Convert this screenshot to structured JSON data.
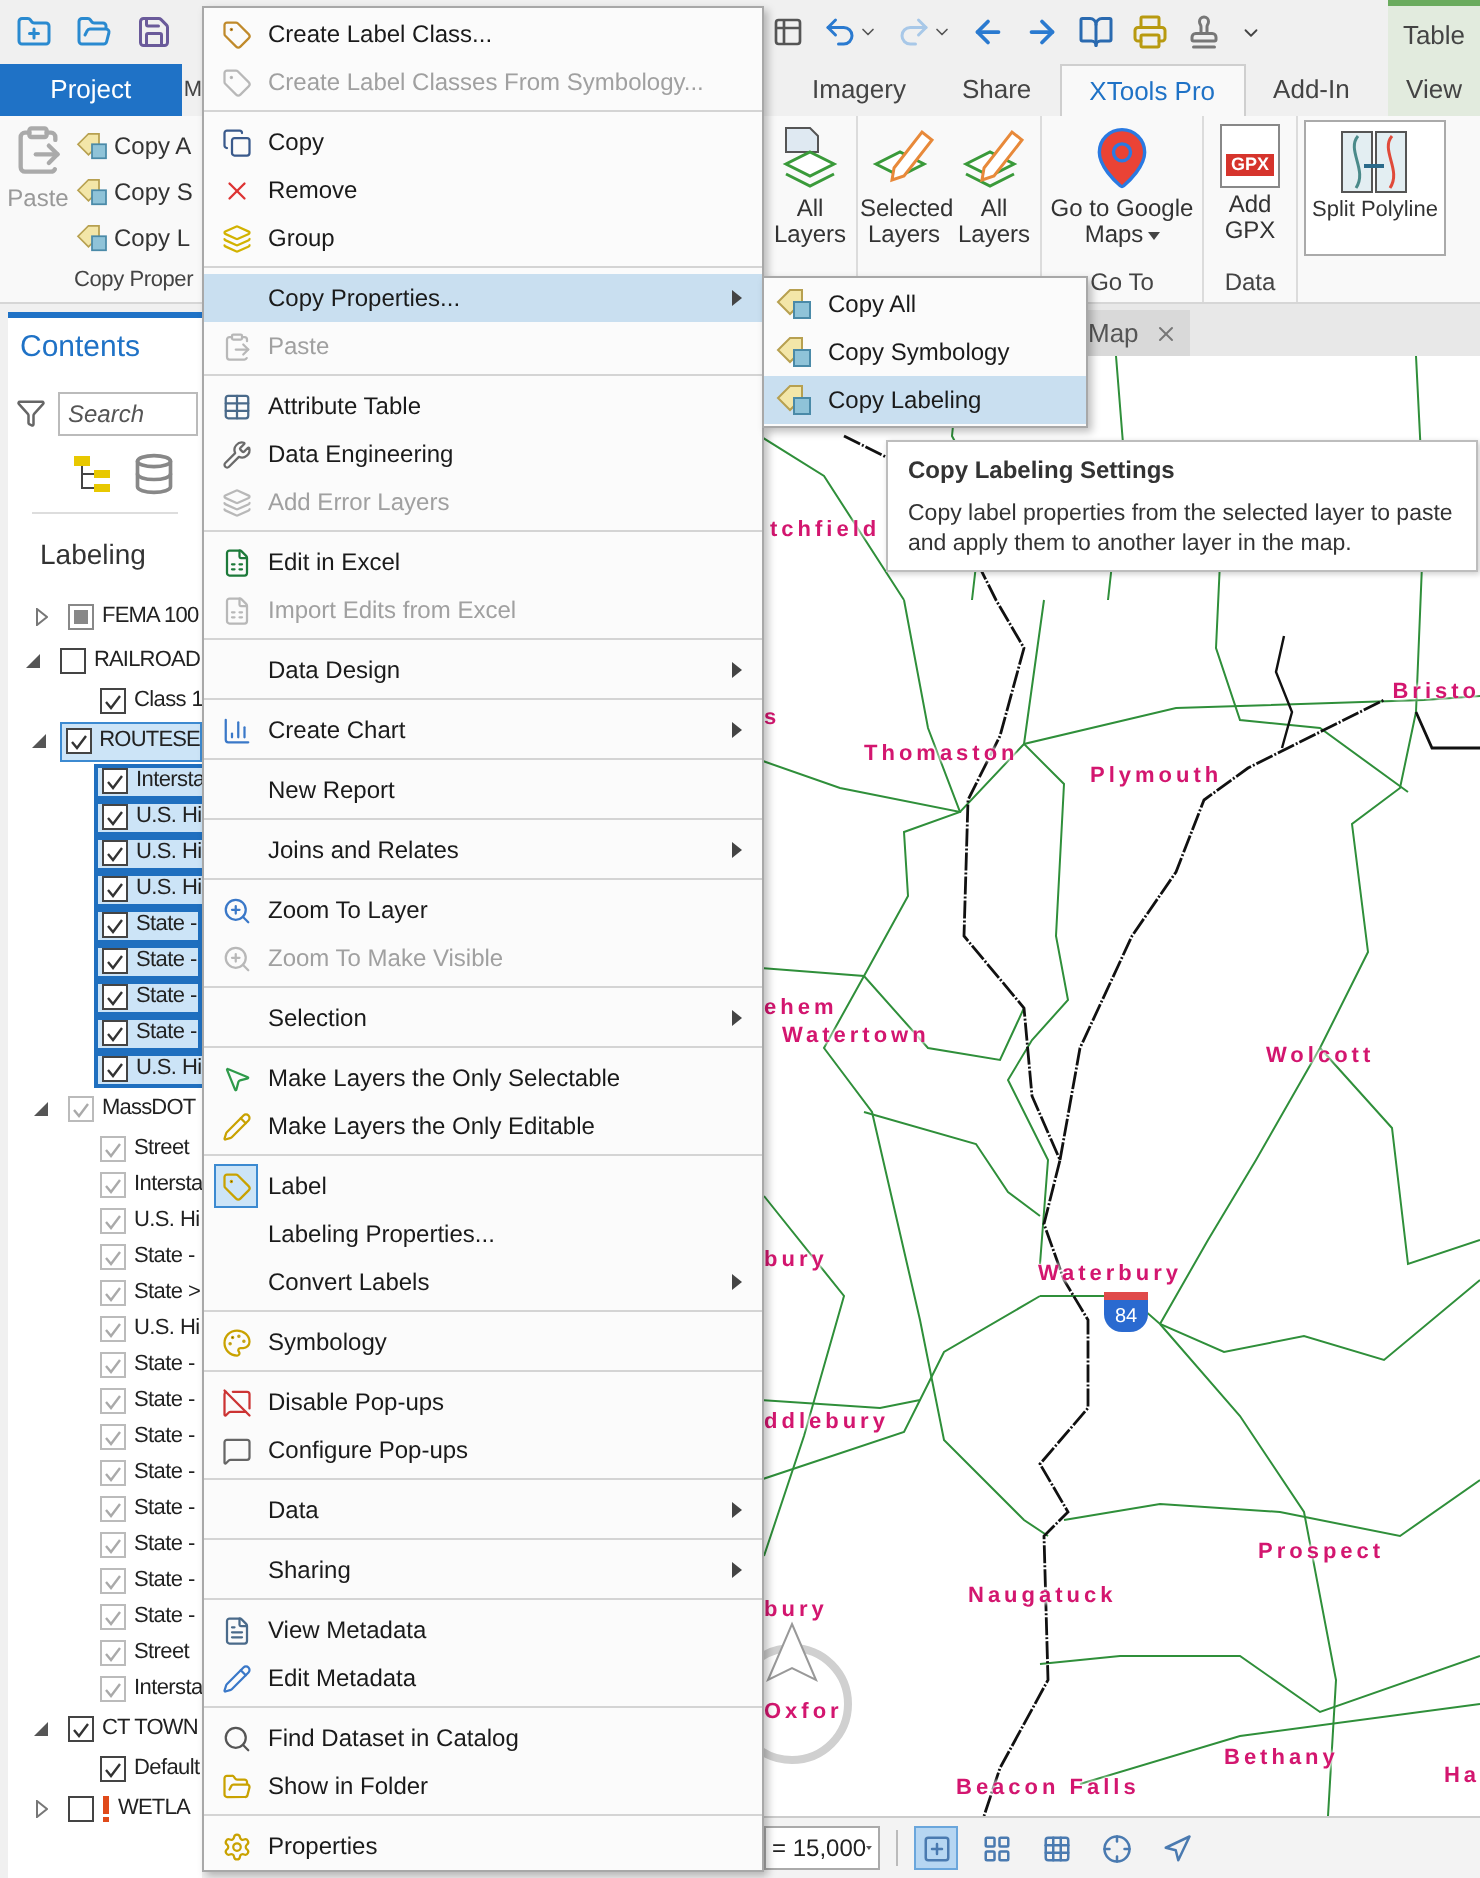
{
  "tabs_left": [
    {
      "label": "Project",
      "kind": "backstage",
      "selected": false
    },
    {
      "label": "M",
      "kind": "tab",
      "selected": false
    }
  ],
  "tabs_right": [
    {
      "label": "Imagery",
      "kind": "tab",
      "selected": false
    },
    {
      "label": "Share",
      "kind": "tab",
      "selected": false
    },
    {
      "label": "XTools Pro",
      "kind": "tab",
      "selected": true
    },
    {
      "label": "Add-In",
      "kind": "tab",
      "selected": false
    },
    {
      "label": "View",
      "kind": "contextual",
      "selected": false
    }
  ],
  "contextual_label": "Table",
  "ribbon_left": {
    "paste": "Paste",
    "buttons": [
      "Copy A",
      "Copy S",
      "Copy L"
    ],
    "group_label": "Copy Proper"
  },
  "ribbon_groups": [
    {
      "buttons": [
        {
          "label": "All Layers",
          "dropdown": false
        }
      ]
    },
    {
      "buttons": [
        {
          "label": "Selected Layers",
          "dropdown": false
        },
        {
          "label": "All Layers",
          "dropdown": false
        }
      ]
    },
    {
      "label": "Go To",
      "buttons": [
        {
          "label": "Go to Google Maps",
          "dropdown": true
        }
      ]
    },
    {
      "label": "Data",
      "buttons": [
        {
          "label": "Add GPX",
          "dropdown": false,
          "icon_text": "GPX"
        }
      ]
    },
    {
      "buttons": [
        {
          "label": "Split Polyline",
          "dropdown": false
        }
      ]
    }
  ],
  "contents": {
    "title": "Contents",
    "search_placeholder": "Search",
    "heading": "Labeling",
    "layers": [
      {
        "label": "FEMA 100",
        "expanded": false,
        "checked": false,
        "partial": true,
        "dimmed": false,
        "selected": false,
        "warning": false
      },
      {
        "label": "RAILROAD",
        "expanded": true,
        "checked": false,
        "partial": false,
        "dimmed": false,
        "selected": false,
        "warning": false,
        "children": [
          {
            "label": "Class 1",
            "checked": true,
            "dimmed": false,
            "selected": false
          }
        ]
      },
      {
        "label": "ROUTESE",
        "expanded": true,
        "checked": true,
        "partial": false,
        "dimmed": false,
        "selected": true,
        "warning": false,
        "children": [
          {
            "label": "Intersta",
            "checked": true,
            "dimmed": false,
            "selected": true
          },
          {
            "label": "U.S. Hi",
            "checked": true,
            "dimmed": false,
            "selected": true
          },
          {
            "label": "U.S. Hi",
            "checked": true,
            "dimmed": false,
            "selected": true
          },
          {
            "label": "U.S. Hi",
            "checked": true,
            "dimmed": false,
            "selected": true
          },
          {
            "label": "State -",
            "checked": true,
            "dimmed": false,
            "selected": true
          },
          {
            "label": "State -",
            "checked": true,
            "dimmed": false,
            "selected": true
          },
          {
            "label": "State -",
            "checked": true,
            "dimmed": false,
            "selected": true
          },
          {
            "label": "State -",
            "checked": true,
            "dimmed": false,
            "selected": true
          },
          {
            "label": "U.S. Hi",
            "checked": true,
            "dimmed": false,
            "selected": true
          }
        ]
      },
      {
        "label": "MassDOT",
        "expanded": true,
        "checked": true,
        "partial": false,
        "dimmed": true,
        "selected": false,
        "warning": false,
        "children": [
          {
            "label": "Street",
            "checked": true,
            "dimmed": true,
            "selected": false
          },
          {
            "label": "Intersta",
            "checked": true,
            "dimmed": true,
            "selected": false
          },
          {
            "label": "U.S. Hi",
            "checked": true,
            "dimmed": true,
            "selected": false
          },
          {
            "label": "State -",
            "checked": true,
            "dimmed": true,
            "selected": false
          },
          {
            "label": "State >",
            "checked": true,
            "dimmed": true,
            "selected": false
          },
          {
            "label": "U.S. Hi",
            "checked": true,
            "dimmed": true,
            "selected": false
          },
          {
            "label": "State -",
            "checked": true,
            "dimmed": true,
            "selected": false
          },
          {
            "label": "State -",
            "checked": true,
            "dimmed": true,
            "selected": false
          },
          {
            "label": "State -",
            "checked": true,
            "dimmed": true,
            "selected": false
          },
          {
            "label": "State -",
            "checked": true,
            "dimmed": true,
            "selected": false
          },
          {
            "label": "State -",
            "checked": true,
            "dimmed": true,
            "selected": false
          },
          {
            "label": "State -",
            "checked": true,
            "dimmed": true,
            "selected": false
          },
          {
            "label": "State -",
            "checked": true,
            "dimmed": true,
            "selected": false
          },
          {
            "label": "State -",
            "checked": true,
            "dimmed": true,
            "selected": false
          },
          {
            "label": "Street",
            "checked": true,
            "dimmed": true,
            "selected": false
          },
          {
            "label": "Intersta",
            "checked": true,
            "dimmed": true,
            "selected": false
          }
        ]
      },
      {
        "label": "CT TOWN",
        "expanded": true,
        "checked": true,
        "partial": false,
        "dimmed": false,
        "selected": false,
        "warning": false,
        "children": [
          {
            "label": "Default",
            "checked": true,
            "dimmed": false,
            "selected": false
          }
        ]
      },
      {
        "label": "WETLA",
        "expanded": false,
        "checked": false,
        "partial": false,
        "dimmed": false,
        "selected": false,
        "warning": true
      }
    ]
  },
  "context_menu": {
    "groups": [
      [
        {
          "label": "Create Label Class...",
          "disabled": false,
          "submenu": false,
          "highlighted": false,
          "checked": false
        },
        {
          "label": "Create Label Classes From Symbology...",
          "disabled": true,
          "submenu": false,
          "highlighted": false,
          "checked": false
        }
      ],
      [
        {
          "label": "Copy",
          "disabled": false,
          "submenu": false,
          "highlighted": false,
          "checked": false
        },
        {
          "label": "Remove",
          "disabled": false,
          "submenu": false,
          "highlighted": false,
          "checked": false
        },
        {
          "label": "Group",
          "disabled": false,
          "submenu": false,
          "highlighted": false,
          "checked": false
        }
      ],
      [
        {
          "label": "Copy Properties...",
          "disabled": false,
          "submenu": true,
          "highlighted": true,
          "checked": false
        },
        {
          "label": "Paste",
          "disabled": true,
          "submenu": false,
          "highlighted": false,
          "checked": false
        }
      ],
      [
        {
          "label": "Attribute Table",
          "disabled": false,
          "submenu": false,
          "highlighted": false,
          "checked": false
        },
        {
          "label": "Data Engineering",
          "disabled": false,
          "submenu": false,
          "highlighted": false,
          "checked": false
        },
        {
          "label": "Add Error Layers",
          "disabled": true,
          "submenu": false,
          "highlighted": false,
          "checked": false
        }
      ],
      [
        {
          "label": "Edit in Excel",
          "disabled": false,
          "submenu": false,
          "highlighted": false,
          "checked": false
        },
        {
          "label": "Import Edits from Excel",
          "disabled": true,
          "submenu": false,
          "highlighted": false,
          "checked": false
        }
      ],
      [
        {
          "label": "Data Design",
          "disabled": false,
          "submenu": true,
          "highlighted": false,
          "checked": false
        }
      ],
      [
        {
          "label": "Create Chart",
          "disabled": false,
          "submenu": true,
          "highlighted": false,
          "checked": false
        }
      ],
      [
        {
          "label": "New Report",
          "disabled": false,
          "submenu": false,
          "highlighted": false,
          "checked": false
        }
      ],
      [
        {
          "label": "Joins and Relates",
          "disabled": false,
          "submenu": true,
          "highlighted": false,
          "checked": false
        }
      ],
      [
        {
          "label": "Zoom To Layer",
          "disabled": false,
          "submenu": false,
          "highlighted": false,
          "checked": false
        },
        {
          "label": "Zoom To Make Visible",
          "disabled": true,
          "submenu": false,
          "highlighted": false,
          "checked": false
        }
      ],
      [
        {
          "label": "Selection",
          "disabled": false,
          "submenu": true,
          "highlighted": false,
          "checked": false
        }
      ],
      [
        {
          "label": "Make Layers the Only Selectable",
          "disabled": false,
          "submenu": false,
          "highlighted": false,
          "checked": false
        },
        {
          "label": "Make Layers the Only Editable",
          "disabled": false,
          "submenu": false,
          "highlighted": false,
          "checked": false
        }
      ],
      [
        {
          "label": "Label",
          "disabled": false,
          "submenu": false,
          "highlighted": false,
          "checked": true
        },
        {
          "label": "Labeling Properties...",
          "disabled": false,
          "submenu": false,
          "highlighted": false,
          "checked": false
        },
        {
          "label": "Convert Labels",
          "disabled": false,
          "submenu": true,
          "highlighted": false,
          "checked": false
        }
      ],
      [
        {
          "label": "Symbology",
          "disabled": false,
          "submenu": false,
          "highlighted": false,
          "checked": false
        }
      ],
      [
        {
          "label": "Disable Pop-ups",
          "disabled": false,
          "submenu": false,
          "highlighted": false,
          "checked": false
        },
        {
          "label": "Configure Pop-ups",
          "disabled": false,
          "submenu": false,
          "highlighted": false,
          "checked": false
        }
      ],
      [
        {
          "label": "Data",
          "disabled": false,
          "submenu": true,
          "highlighted": false,
          "checked": false
        }
      ],
      [
        {
          "label": "Sharing",
          "disabled": false,
          "submenu": true,
          "highlighted": false,
          "checked": false
        }
      ],
      [
        {
          "label": "View Metadata",
          "disabled": false,
          "submenu": false,
          "highlighted": false,
          "checked": false
        },
        {
          "label": "Edit Metadata",
          "disabled": false,
          "submenu": false,
          "highlighted": false,
          "checked": false
        }
      ],
      [
        {
          "label": "Find Dataset in Catalog",
          "disabled": false,
          "submenu": false,
          "highlighted": false,
          "checked": false
        },
        {
          "label": "Show in Folder",
          "disabled": false,
          "submenu": false,
          "highlighted": false,
          "checked": false
        }
      ],
      [
        {
          "label": "Properties",
          "disabled": false,
          "submenu": false,
          "highlighted": false,
          "checked": false
        }
      ]
    ]
  },
  "submenu": {
    "items": [
      {
        "label": "Copy All",
        "highlighted": false
      },
      {
        "label": "Copy Symbology",
        "highlighted": false
      },
      {
        "label": "Copy Labeling",
        "highlighted": true
      }
    ]
  },
  "tooltip": {
    "title": "Copy Labeling Settings",
    "text": "Copy label properties from the selected layer to paste and apply them to another layer in the map."
  },
  "map": {
    "tab": "Map",
    "labels": [
      {
        "text": "tchfield"
      },
      {
        "text": "s"
      },
      {
        "text": "Thomaston"
      },
      {
        "text": "Plymouth"
      },
      {
        "text": "Bristo"
      },
      {
        "text": "ehem"
      },
      {
        "text": "Watertown"
      },
      {
        "text": "Wolcott"
      },
      {
        "text": "bury"
      },
      {
        "text": "Waterbury"
      },
      {
        "text": "ddlebury"
      },
      {
        "text": "Prospect"
      },
      {
        "text": "Naugatuck"
      },
      {
        "text": "bury"
      },
      {
        "text": "Oxfor"
      },
      {
        "text": "Beacon Falls"
      },
      {
        "text": "Bethany"
      },
      {
        "text": "Ha"
      }
    ],
    "shield": "84"
  },
  "status_bar": {
    "scale": "= 15,000",
    "tools": [
      {
        "selected": true
      },
      {
        "selected": false
      },
      {
        "selected": false
      },
      {
        "selected": false
      },
      {
        "selected": false
      }
    ]
  }
}
